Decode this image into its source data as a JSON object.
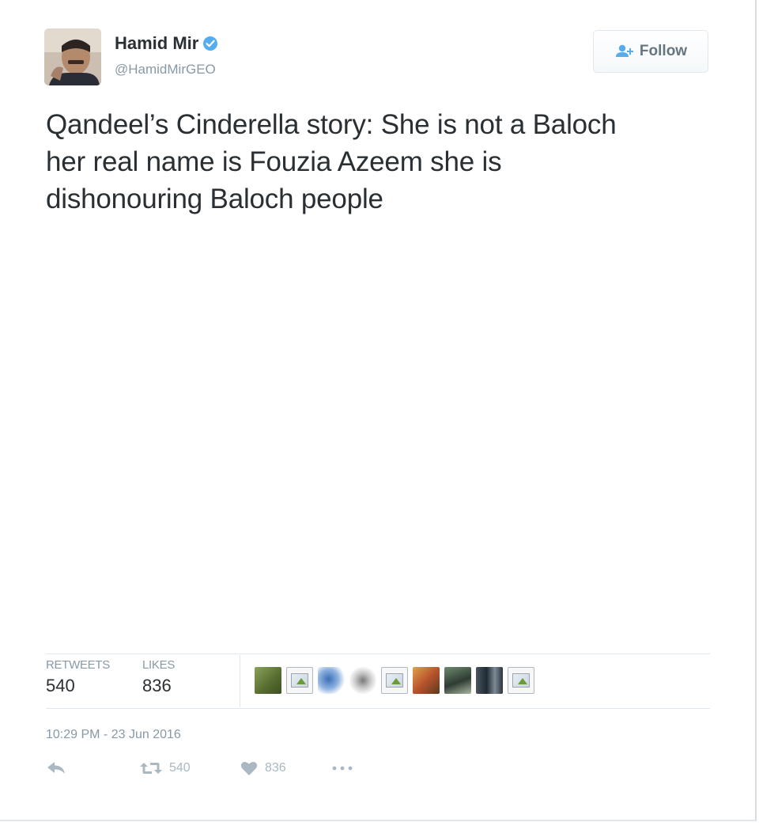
{
  "user": {
    "display_name": "Hamid Mir",
    "handle": "@HamidMirGEO",
    "verified": true
  },
  "follow_button": {
    "label": "Follow",
    "icon": "follow-person-icon"
  },
  "tweet": {
    "lines": [
      "Qandeel’s Cinderella story: She is not a Baloch",
      "her real name is Fouzia Azeem she is",
      "dishonouring Baloch people"
    ]
  },
  "stats": {
    "retweets_label": "RETWEETS",
    "retweets_value": "540",
    "likes_label": "LIKES",
    "likes_value": "836"
  },
  "timestamp": "10:29 PM - 23 Jun 2016",
  "actions": {
    "reply_icon": "reply-icon",
    "retweet_icon": "retweet-icon",
    "retweet_count": "540",
    "like_icon": "heart-icon",
    "like_count": "836",
    "more_icon": "more-dots-icon"
  },
  "colors": {
    "text": "#292f33",
    "muted": "#8899a6",
    "border": "#e1e8ed",
    "verified_blue": "#55acee",
    "action_gray": "#aab8c2"
  }
}
